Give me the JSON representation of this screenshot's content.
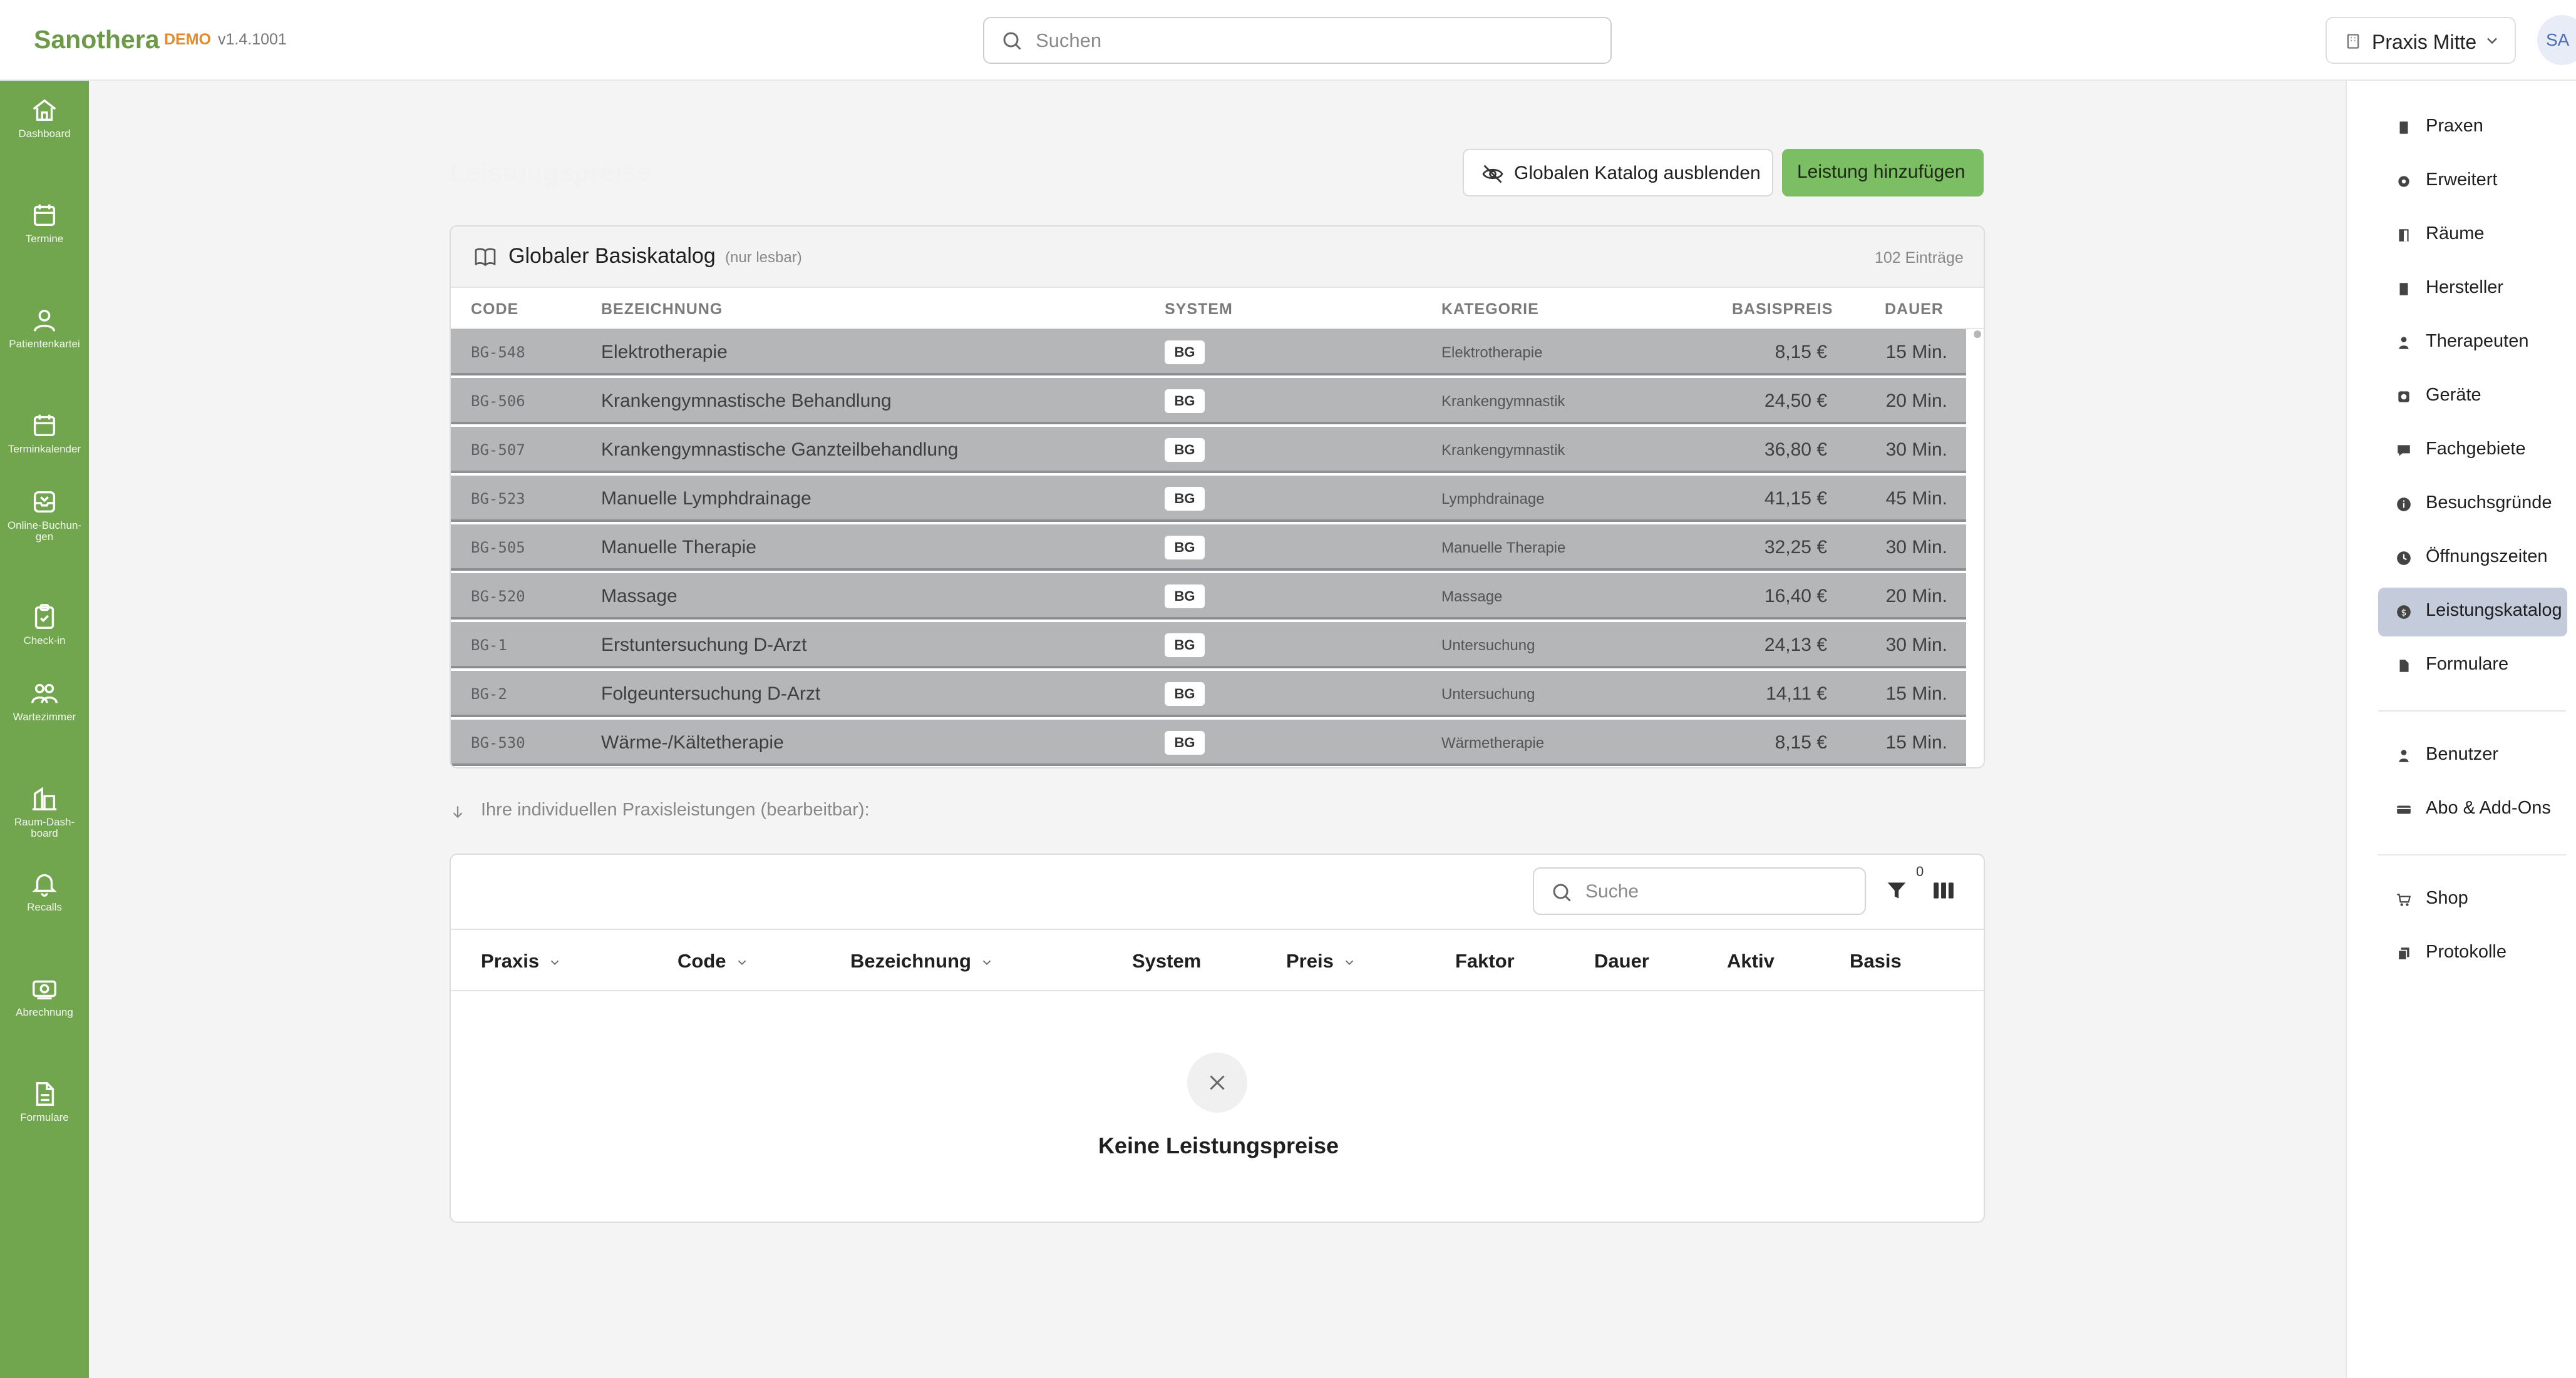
{
  "header": {
    "brand": "Sanothera",
    "badge": "DEMO",
    "version": "v1.4.1001",
    "search_placeholder": "Suchen",
    "praxis_label": "Praxis Mitte",
    "avatar_initials": "SA"
  },
  "left_nav": [
    {
      "label": "Dashboard",
      "icon": "home-icon"
    },
    {
      "label": "Termine",
      "icon": "calendar-icon"
    },
    {
      "label": "Patientenkartei",
      "icon": "person-icon"
    },
    {
      "label": "Terminkalender",
      "icon": "calendar-icon"
    },
    {
      "label": "Online-Buchun-\ngen",
      "icon": "inbox-icon"
    },
    {
      "label": "Check-in",
      "icon": "clipboard-check-icon"
    },
    {
      "label": "Wartezimmer",
      "icon": "users-icon"
    },
    {
      "label": "Raum-Dash-\nboard",
      "icon": "building-chart-icon"
    },
    {
      "label": "Recalls",
      "icon": "bell-icon"
    },
    {
      "label": "Abrechnung",
      "icon": "money-icon"
    },
    {
      "label": "Formulare",
      "icon": "document-icon"
    }
  ],
  "page": {
    "title": "Leistungspreise",
    "hide_catalog_label": "Globalen Katalog ausblenden",
    "add_label": "Leistung hinzufügen"
  },
  "catalog": {
    "title": "Globaler Basiskatalog",
    "note": "(nur lesbar)",
    "count": "102 Einträge",
    "columns": [
      "CODE",
      "BEZEICHNUNG",
      "SYSTEM",
      "KATEGORIE",
      "BASISPREIS",
      "DAUER"
    ],
    "rows": [
      {
        "code": "BG-548",
        "bez": "Elektrotherapie",
        "sys": "BG",
        "kat": "Elektrotherapie",
        "price": "8,15 €",
        "dur": "15 Min."
      },
      {
        "code": "BG-506",
        "bez": "Krankengymnastische Behandlung",
        "sys": "BG",
        "kat": "Krankengymnastik",
        "price": "24,50 €",
        "dur": "20 Min."
      },
      {
        "code": "BG-507",
        "bez": "Krankengymnastische Ganzteilbehandlung",
        "sys": "BG",
        "kat": "Krankengymnastik",
        "price": "36,80 €",
        "dur": "30 Min."
      },
      {
        "code": "BG-523",
        "bez": "Manuelle Lymphdrainage",
        "sys": "BG",
        "kat": "Lymphdrainage",
        "price": "41,15 €",
        "dur": "45 Min."
      },
      {
        "code": "BG-505",
        "bez": "Manuelle Therapie",
        "sys": "BG",
        "kat": "Manuelle Therapie",
        "price": "32,25 €",
        "dur": "30 Min."
      },
      {
        "code": "BG-520",
        "bez": "Massage",
        "sys": "BG",
        "kat": "Massage",
        "price": "16,40 €",
        "dur": "20 Min."
      },
      {
        "code": "BG-1",
        "bez": "Erstuntersuchung D-Arzt",
        "sys": "BG",
        "kat": "Untersuchung",
        "price": "24,13 €",
        "dur": "30 Min."
      },
      {
        "code": "BG-2",
        "bez": "Folgeuntersuchung D-Arzt",
        "sys": "BG",
        "kat": "Untersuchung",
        "price": "14,11 €",
        "dur": "15 Min."
      },
      {
        "code": "BG-530",
        "bez": "Wärme-/Kältetherapie",
        "sys": "BG",
        "kat": "Wärmetherapie",
        "price": "8,15 €",
        "dur": "15 Min."
      }
    ]
  },
  "individual": {
    "hint": "Ihre individuellen Praxisleistungen (bearbeitbar):",
    "search_placeholder": "Suche",
    "filter_count": "0",
    "columns": [
      {
        "label": "Praxis",
        "sortable": true
      },
      {
        "label": "Code",
        "sortable": true
      },
      {
        "label": "Bezeichnung",
        "sortable": true
      },
      {
        "label": "System",
        "sortable": false
      },
      {
        "label": "Preis",
        "sortable": true
      },
      {
        "label": "Faktor",
        "sortable": false
      },
      {
        "label": "Dauer",
        "sortable": false
      },
      {
        "label": "Aktiv",
        "sortable": false
      },
      {
        "label": "Basis",
        "sortable": false
      }
    ],
    "empty_text": "Keine Leistungspreise"
  },
  "right_nav": {
    "group1": [
      {
        "label": "Praxen",
        "icon": "building-icon"
      },
      {
        "label": "Erweitert",
        "icon": "gear-icon"
      },
      {
        "label": "Räume",
        "icon": "door-icon"
      },
      {
        "label": "Hersteller",
        "icon": "factory-icon"
      },
      {
        "label": "Therapeuten",
        "icon": "person-icon"
      },
      {
        "label": "Geräte",
        "icon": "device-icon"
      },
      {
        "label": "Fachgebiete",
        "icon": "chat-icon"
      },
      {
        "label": "Besuchsgründe",
        "icon": "info-icon"
      },
      {
        "label": "Öffnungszeiten",
        "icon": "clock-icon"
      },
      {
        "label": "Leistungskatalog",
        "icon": "euro-icon",
        "active": true
      },
      {
        "label": "Formulare",
        "icon": "document-icon"
      }
    ],
    "group2": [
      {
        "label": "Benutzer",
        "icon": "user-icon"
      },
      {
        "label": "Abo & Add-Ons",
        "icon": "card-icon"
      }
    ],
    "group3": [
      {
        "label": "Shop",
        "icon": "cart-icon"
      },
      {
        "label": "Protokolle",
        "icon": "log-icon"
      }
    ]
  },
  "colors": {
    "brand_green": "#71a64f",
    "accent_green": "#7bbe63",
    "demo_orange": "#e58a2b",
    "active_nav": "#c4ccdc"
  }
}
